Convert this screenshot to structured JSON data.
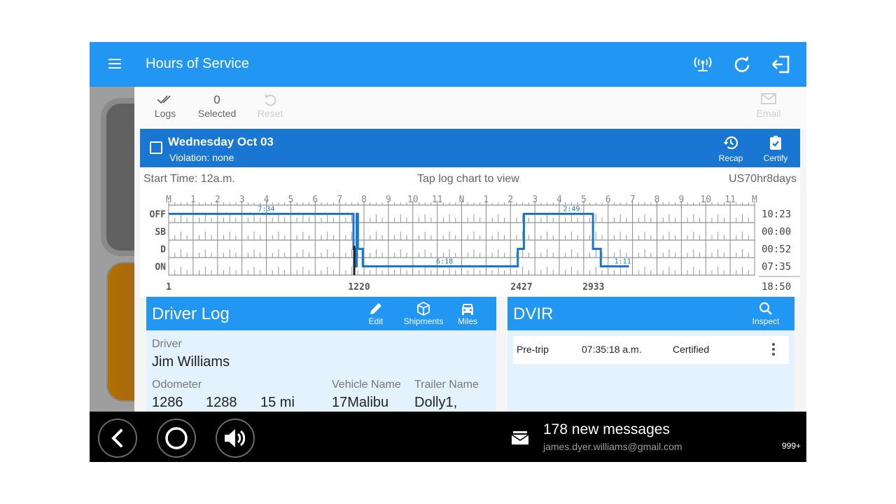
{
  "app": {
    "title": "Hours of Service",
    "accent": "#2196F3",
    "dark_accent": "#1976D2"
  },
  "appbar": {
    "icons": [
      "menu-icon",
      "wifi-tower-icon",
      "refresh-icon",
      "logout-icon"
    ]
  },
  "toolbar": {
    "logs_label": "Logs",
    "selected_count": "0",
    "selected_label": "Selected",
    "reset_label": "Reset",
    "email_label": "Email"
  },
  "log_day": {
    "date": "Wednesday Oct 03",
    "violation": "Violation: none",
    "recap_label": "Recap",
    "certify_label": "Certify"
  },
  "chart_info": {
    "start_time": "Start Time: 12a.m.",
    "tap_hint": "Tap log chart to view",
    "rule_set": "US70hr8days"
  },
  "chart_data": {
    "type": "line",
    "hour_labels": [
      "M",
      "1",
      "2",
      "3",
      "4",
      "5",
      "6",
      "7",
      "8",
      "9",
      "10",
      "11",
      "N",
      "1",
      "2",
      "3",
      "4",
      "5",
      "6",
      "7",
      "8",
      "9",
      "10",
      "11",
      "M"
    ],
    "status_labels": [
      "OFF",
      "SB",
      "D",
      "ON"
    ],
    "status_totals": [
      "10:23",
      "00:00",
      "00:52",
      "07:35"
    ],
    "grand_total": "18:50",
    "bottom_labels": [
      "1",
      "1220",
      "2427",
      "2933"
    ],
    "duration_labels": [
      {
        "text": "7:34",
        "hour": 4.0,
        "status": "OFF"
      },
      {
        "text": "6:18",
        "hour": 11.3,
        "status": "ON"
      },
      {
        "text": "2:49",
        "hour": 16.5,
        "status": "OFF"
      },
      {
        "text": "1:11",
        "hour": 18.6,
        "status": "ON"
      }
    ],
    "segments": [
      {
        "status": "OFF",
        "start": 0.0,
        "end": 7.57
      },
      {
        "status": "D",
        "start": 7.57,
        "end": 7.65
      },
      {
        "status": "ON",
        "start": 7.65,
        "end": 7.7
      },
      {
        "status": "OFF",
        "start": 7.7,
        "end": 7.75
      },
      {
        "status": "D",
        "start": 7.75,
        "end": 7.95
      },
      {
        "status": "ON",
        "start": 7.95,
        "end": 14.3
      },
      {
        "status": "D",
        "start": 14.3,
        "end": 14.55
      },
      {
        "status": "OFF",
        "start": 14.55,
        "end": 17.38
      },
      {
        "status": "D",
        "start": 17.38,
        "end": 17.7
      },
      {
        "status": "ON",
        "start": 17.7,
        "end": 18.85
      }
    ],
    "line_color": "#1976D2"
  },
  "driver_log": {
    "title": "Driver Log",
    "edit_label": "Edit",
    "shipments_label": "Shipments",
    "miles_label": "Miles",
    "driver_label": "Driver",
    "driver_name": "Jim Williams",
    "odometer_label": "Odometer",
    "odometer_start": "1286",
    "odometer_end": "1288",
    "distance": "15 mi",
    "vehicle_label": "Vehicle Name",
    "vehicle_value": "17Malibu",
    "trailer_label": "Trailer Name",
    "trailer_value": "Dolly1,"
  },
  "dvir": {
    "title": "DVIR",
    "inspect_label": "Inspect",
    "rows": [
      {
        "type": "Pre-trip",
        "time": "07:35:18 a.m.",
        "status": "Certified"
      }
    ]
  },
  "system_nav": {
    "notification_title": "178 new messages",
    "notification_sub": "james.dyer.williams@gmail.com",
    "notification_count": "999+"
  }
}
